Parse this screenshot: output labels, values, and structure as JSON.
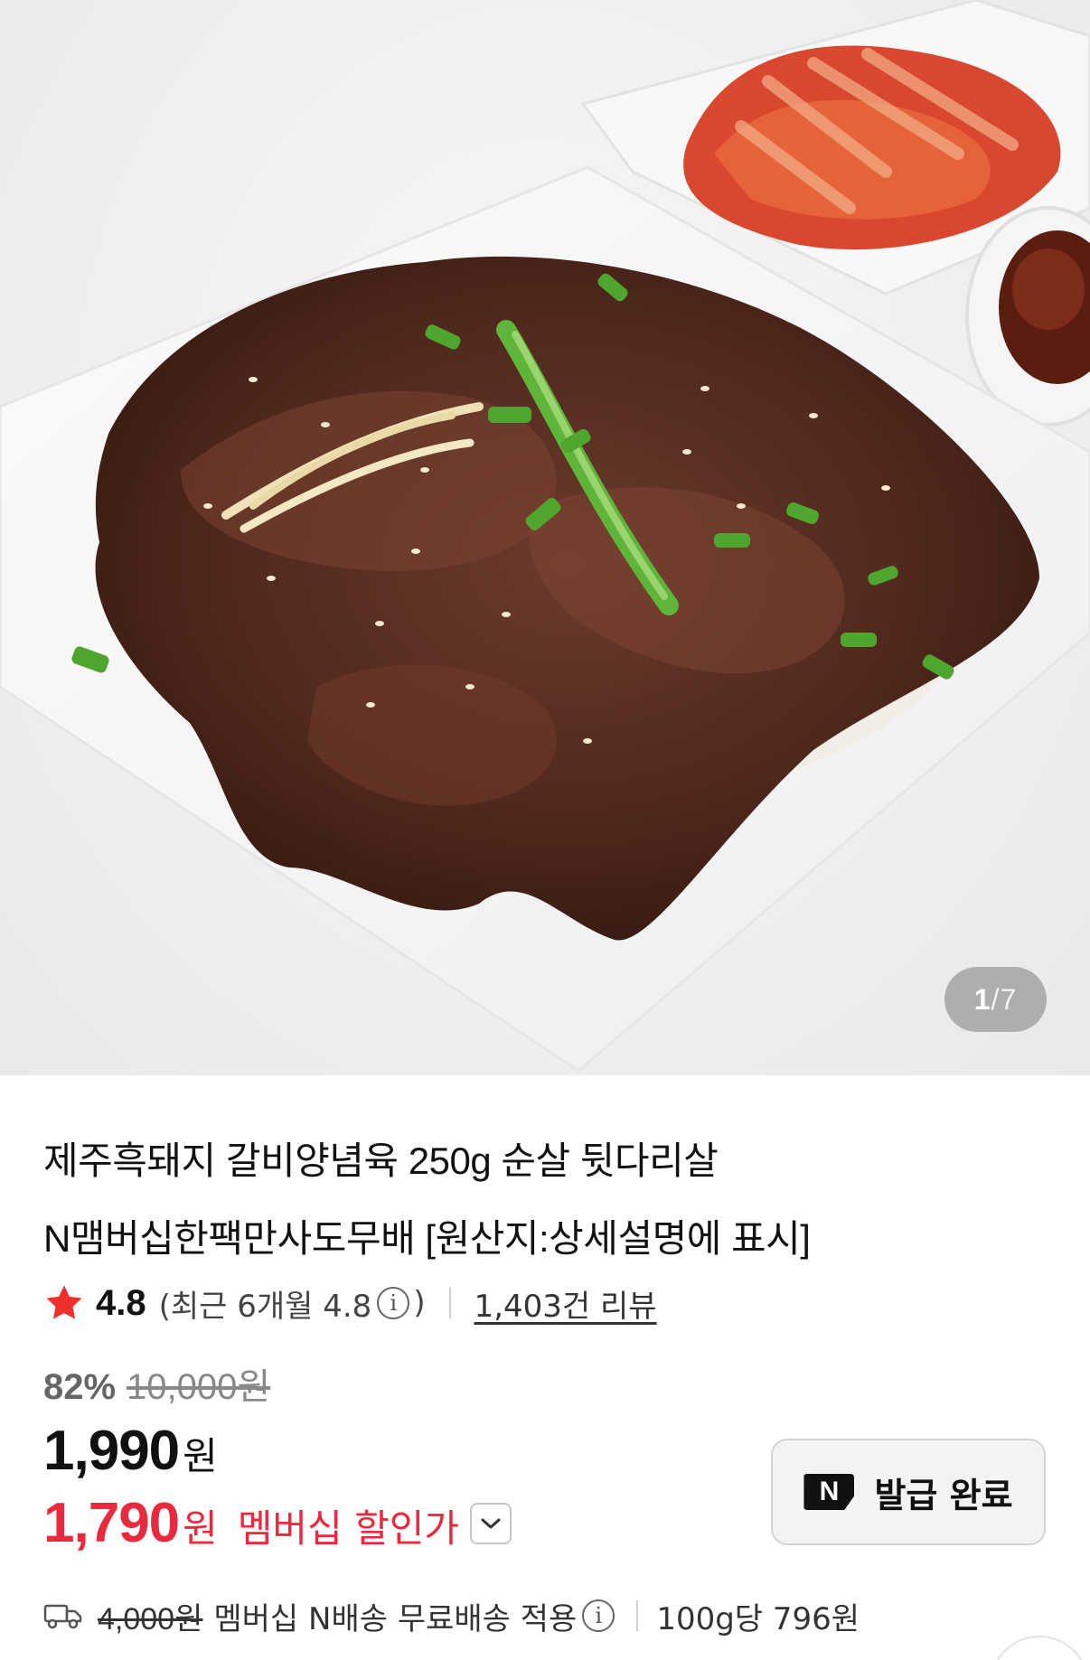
{
  "gallery": {
    "current": "1",
    "separator": "/",
    "total": "7"
  },
  "product": {
    "title_line1": "제주흑돼지 갈비양념육 250g 순살 뒷다리살",
    "title_line2": "N맴버십한팩만사도무배 [원산지:상세설명에 표시]"
  },
  "rating": {
    "score": "4.8",
    "recent_open": "(최근 6개월 4.8",
    "recent_close": ")",
    "review_count": "1,403건 리뷰"
  },
  "pricing": {
    "discount_rate": "82%",
    "original_price": "10,000원",
    "price": "1,990",
    "price_unit": "원",
    "member_price": "1,790",
    "member_unit": "원",
    "member_label": "멤버십 할인가"
  },
  "coupon": {
    "badge": "N",
    "label": "발급 완료"
  },
  "shipping": {
    "original_fee": "4,000원",
    "text": "멤버십 N배송 무료배송 적용",
    "unit_price": "100g당 796원"
  },
  "icons": {
    "star": "star-icon",
    "info": "info-icon",
    "chevron": "chevron-down-icon",
    "truck": "truck-icon"
  },
  "colors": {
    "accent_red": "#e8293e",
    "star_red": "#f0302c",
    "text_dark": "#111111",
    "text_muted": "#888888"
  }
}
